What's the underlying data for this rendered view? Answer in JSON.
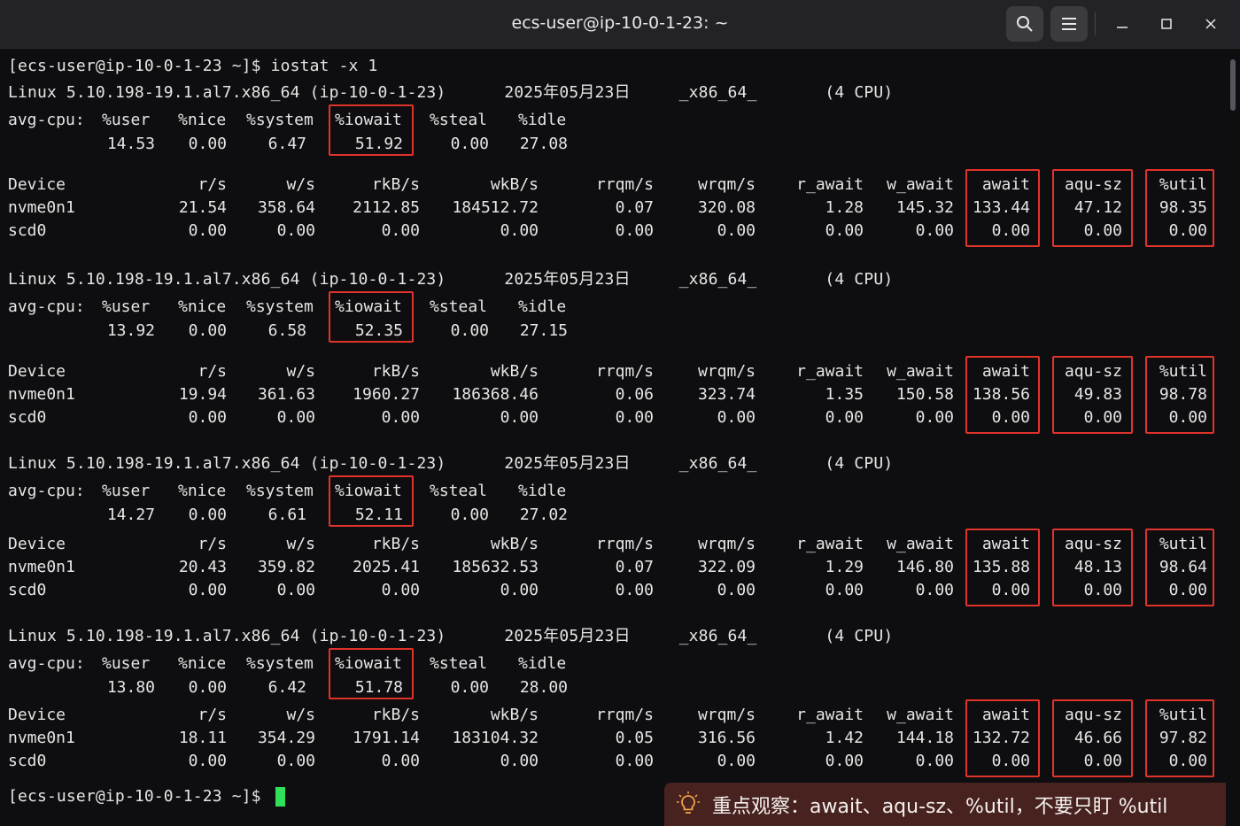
{
  "window": {
    "title": "ecs-user@ip-10-0-1-23: ~"
  },
  "terminal": {
    "prompt_cmd": "[ecs-user@ip-10-0-1-23 ~]$ iostat -x 1",
    "sys_line": "Linux 5.10.198-19.1.al7.x86_64 (ip-10-0-1-23)      2025年05月23日     _x86_64_       (4 CPU)",
    "cpu_labels": {
      "head": "avg-cpu:",
      "user": "%user",
      "nice": "%nice",
      "system": "%system",
      "iowait": "%iowait",
      "steal": "%steal",
      "idle": "%idle"
    },
    "dev_headers": {
      "device": "Device",
      "rs": "r/s",
      "ws": "w/s",
      "rkbs": "rkB/s",
      "wkbs": "wkB/s",
      "rrqms": "rrqm/s",
      "wrqms": "wrqm/s",
      "r_await": "r_await",
      "w_await": "w_await",
      "await": "await",
      "aqusz": "aqu-sz",
      "util": "%util"
    },
    "blocks": [
      {
        "cpu": {
          "user": "14.53",
          "nice": "0.00",
          "system": "6.47",
          "iowait": "51.92",
          "steal": "0.00",
          "idle": "27.08"
        },
        "rows": [
          {
            "device": "nvme0n1",
            "rs": "21.54",
            "ws": "358.64",
            "rkbs": "2112.85",
            "wkbs": "184512.72",
            "rrqms": "0.07",
            "wrqms": "320.08",
            "r_await": "1.28",
            "w_await": "145.32",
            "await": "133.44",
            "aqusz": "47.12",
            "util": "98.35"
          },
          {
            "device": "scd0",
            "rs": "0.00",
            "ws": "0.00",
            "rkbs": "0.00",
            "wkbs": "0.00",
            "rrqms": "0.00",
            "wrqms": "0.00",
            "r_await": "0.00",
            "w_await": "0.00",
            "await": "0.00",
            "aqusz": "0.00",
            "util": "0.00"
          }
        ]
      },
      {
        "cpu": {
          "user": "13.92",
          "nice": "0.00",
          "system": "6.58",
          "iowait": "52.35",
          "steal": "0.00",
          "idle": "27.15"
        },
        "rows": [
          {
            "device": "nvme0n1",
            "rs": "19.94",
            "ws": "361.63",
            "rkbs": "1960.27",
            "wkbs": "186368.46",
            "rrqms": "0.06",
            "wrqms": "323.74",
            "r_await": "1.35",
            "w_await": "150.58",
            "await": "138.56",
            "aqusz": "49.83",
            "util": "98.78"
          },
          {
            "device": "scd0",
            "rs": "0.00",
            "ws": "0.00",
            "rkbs": "0.00",
            "wkbs": "0.00",
            "rrqms": "0.00",
            "wrqms": "0.00",
            "r_await": "0.00",
            "w_await": "0.00",
            "await": "0.00",
            "aqusz": "0.00",
            "util": "0.00"
          }
        ]
      },
      {
        "cpu": {
          "user": "14.27",
          "nice": "0.00",
          "system": "6.61",
          "iowait": "52.11",
          "steal": "0.00",
          "idle": "27.02"
        },
        "rows": [
          {
            "device": "nvme0n1",
            "rs": "20.43",
            "ws": "359.82",
            "rkbs": "2025.41",
            "wkbs": "185632.53",
            "rrqms": "0.07",
            "wrqms": "322.09",
            "r_await": "1.29",
            "w_await": "146.80",
            "await": "135.88",
            "aqusz": "48.13",
            "util": "98.64"
          },
          {
            "device": "scd0",
            "rs": "0.00",
            "ws": "0.00",
            "rkbs": "0.00",
            "wkbs": "0.00",
            "rrqms": "0.00",
            "wrqms": "0.00",
            "r_await": "0.00",
            "w_await": "0.00",
            "await": "0.00",
            "aqusz": "0.00",
            "util": "0.00"
          }
        ]
      },
      {
        "cpu": {
          "user": "13.80",
          "nice": "0.00",
          "system": "6.42",
          "iowait": "51.78",
          "steal": "0.00",
          "idle": "28.00"
        },
        "rows": [
          {
            "device": "nvme0n1",
            "rs": "18.11",
            "ws": "354.29",
            "rkbs": "1791.14",
            "wkbs": "183104.32",
            "rrqms": "0.05",
            "wrqms": "316.56",
            "r_await": "1.42",
            "w_await": "144.18",
            "await": "132.72",
            "aqusz": "46.66",
            "util": "97.82"
          },
          {
            "device": "scd0",
            "rs": "0.00",
            "ws": "0.00",
            "rkbs": "0.00",
            "wkbs": "0.00",
            "rrqms": "0.00",
            "wrqms": "0.00",
            "r_await": "0.00",
            "w_await": "0.00",
            "await": "0.00",
            "aqusz": "0.00",
            "util": "0.00"
          }
        ]
      }
    ],
    "final_prompt": "[ecs-user@ip-10-0-1-23 ~]$ "
  },
  "annotation": {
    "text": "重点观察：await、aqu-sz、%util，不要只盯 %util",
    "icon": "lightbulb-icon"
  },
  "colors": {
    "highlight": "#e0332b",
    "cursor": "#2ee05a",
    "note_bg": "#48221f"
  }
}
